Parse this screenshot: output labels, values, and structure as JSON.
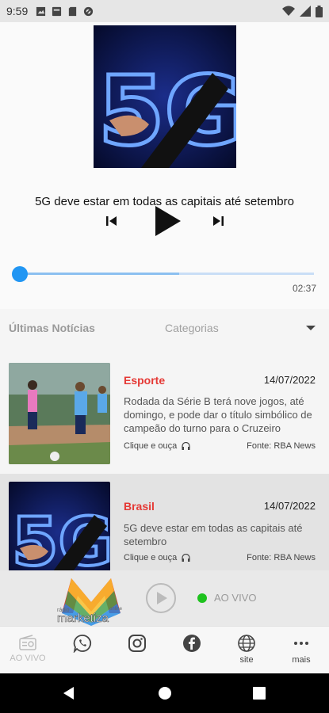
{
  "status": {
    "time": "9:59"
  },
  "player": {
    "cover_text": "5G",
    "track_title": "5G deve estar em todas as capitais até setembro",
    "duration": "02:37",
    "progress": 0.54
  },
  "tabs": {
    "news": "Últimas Notícias",
    "categories": "Categorias"
  },
  "news": [
    {
      "category": "Esporte",
      "date": "14/07/2022",
      "text": "Rodada da Série B terá nove jogos, até domingo, e pode dar o título simbólico de campeão do turno para o Cruzeiro",
      "listen": "Clique e ouça",
      "source": "Fonte: RBA News"
    },
    {
      "category": "Brasil",
      "date": "14/07/2022",
      "text": "5G deve estar em todas as capitais até setembro",
      "listen": "Clique e ouça",
      "source": "Fonte: RBA News"
    }
  ],
  "mini_player": {
    "logo_top": "rádio",
    "logo_main": "marketiza",
    "logo_small": "online",
    "live": "AO VIVO"
  },
  "nav": {
    "aovivo": "AO VIVO",
    "site": "site",
    "mais": "mais"
  },
  "colors": {
    "accent": "#2196f3",
    "category": "#e53935",
    "live": "#1ec21e"
  }
}
